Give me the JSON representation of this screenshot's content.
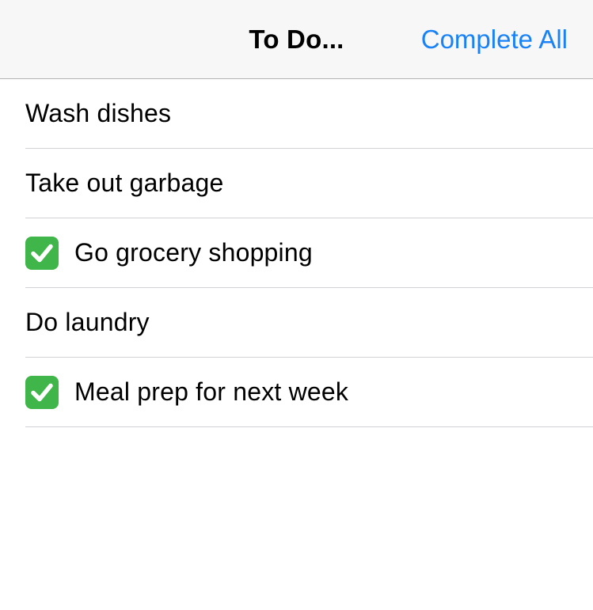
{
  "nav": {
    "title": "To Do...",
    "action_label": "Complete All",
    "action_color": "#1a82f7"
  },
  "todos": [
    {
      "label": "Wash dishes",
      "completed": false
    },
    {
      "label": "Take out garbage",
      "completed": false
    },
    {
      "label": "Go grocery shopping",
      "completed": true,
      "icon": "checkmark-icon"
    },
    {
      "label": "Do laundry",
      "completed": false
    },
    {
      "label": "Meal prep for next week",
      "completed": true,
      "icon": "checkmark-icon"
    }
  ],
  "colors": {
    "check_bg": "#3fb54a",
    "separator": "#d1d1d6",
    "nav_bg": "#f7f7f7"
  }
}
